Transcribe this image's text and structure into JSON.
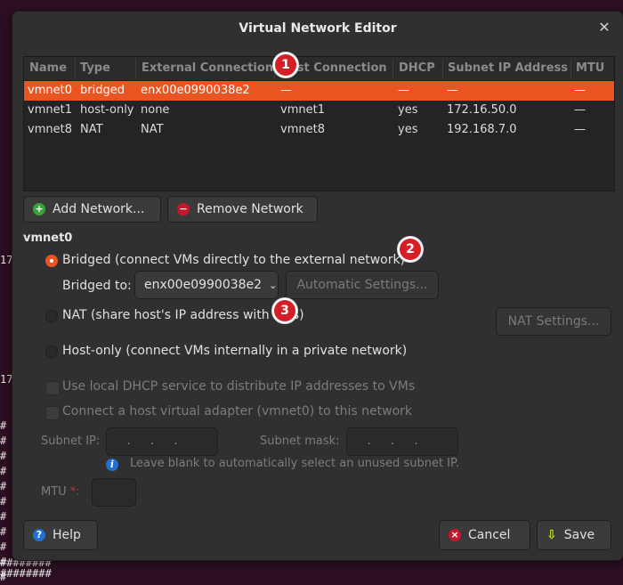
{
  "window": {
    "title": "Virtual Network Editor",
    "close_glyph": "✕"
  },
  "background_text": [
    "17",
    "17",
    "#",
    "#",
    "#",
    "#",
    "#",
    "#",
    "#",
    "#",
    "#",
    "#",
    "#",
    "########",
    "########"
  ],
  "table": {
    "headers": [
      "Name",
      "Type",
      "External Connection",
      "Host Connection",
      "DHCP",
      "Subnet IP Address",
      "MTU"
    ],
    "rows": [
      [
        "vmnet0",
        "bridged",
        "enx00e0990038e2",
        "—",
        "—",
        "—",
        "—"
      ],
      [
        "vmnet1",
        "host-only",
        "none",
        "vmnet1",
        "yes",
        "172.16.50.0",
        "—"
      ],
      [
        "vmnet8",
        "NAT",
        "NAT",
        "vmnet8",
        "yes",
        "192.168.7.0",
        "—"
      ]
    ],
    "selected_row": 0
  },
  "buttons": {
    "add_network": "Add Network...",
    "remove_network": "Remove Network",
    "automatic_settings": "Automatic Settings...",
    "nat_settings": "NAT Settings...",
    "help": "Help",
    "cancel": "Cancel",
    "save": "Save"
  },
  "details": {
    "section_title": "vmnet0",
    "bridged_label": "Bridged (connect VMs directly to the external network)",
    "bridged_to_label": "Bridged to:",
    "bridged_to_value": "enx00e0990038e2",
    "nat_label": "NAT (share host's IP address with VMs)",
    "hostonly_label": "Host-only (connect VMs internally in a private network)",
    "dhcp_check": "Use local DHCP service to distribute IP addresses to VMs",
    "host_adapter_check": "Connect a host virtual adapter (vmnet0) to this network",
    "subnet_ip_label": "Subnet IP:",
    "subnet_mask_label": "Subnet mask:",
    "subnet_hint": "Leave blank to automatically select an unused subnet IP.",
    "mtu_label": "MTU",
    "mtu_required": "*:",
    "ip_dots": "...",
    "selected_mode": "bridged"
  },
  "annotations": [
    "1",
    "2",
    "3"
  ],
  "colors": {
    "accent": "#e95420",
    "badge": "#d41f26",
    "window_bg": "#303030"
  }
}
